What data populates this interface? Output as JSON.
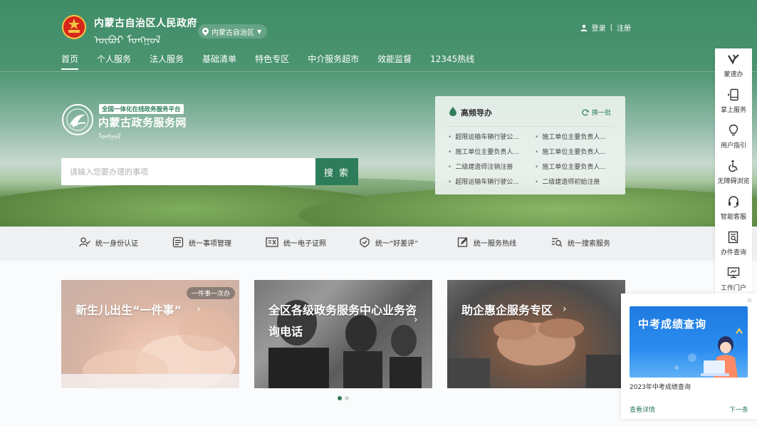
{
  "header": {
    "site_title": "内蒙古自治区人民政府",
    "site_title_mongol": "ᠦᠪᠦᠷ ᠮᠣᠩᠭᠣᠯ",
    "region": "内蒙古自治区",
    "login": "登录",
    "separator": "|",
    "register": "注册"
  },
  "nav": {
    "items": [
      {
        "label": "首页",
        "active": true
      },
      {
        "label": "个人服务"
      },
      {
        "label": "法人服务"
      },
      {
        "label": "基础清单"
      },
      {
        "label": "特色专区"
      },
      {
        "label": "中介服务超市"
      },
      {
        "label": "效能监督"
      },
      {
        "label": "12345热线"
      }
    ]
  },
  "brand": {
    "tag": "全国一体化在线政务服务平台",
    "name": "内蒙古政务服务网",
    "name_mongol": "ᠮᠣᠩᠭᠣᠯ"
  },
  "search": {
    "placeholder": "请输入您要办理的事项",
    "button": "搜 索"
  },
  "hot_panel": {
    "title": "高频导办",
    "refresh": "换一批",
    "items": [
      "超限运输车辆行驶公...",
      "施工单位主要负责人...",
      "施工单位主要负责人...",
      "施工单位主要负责人...",
      "二级建造师注销注册",
      "施工单位主要负责人...",
      "超限运输车辆行驶公...",
      "二级建造师初始注册"
    ]
  },
  "services": [
    {
      "label": "统一身份认证",
      "icon": "identity-icon"
    },
    {
      "label": "统一事项管理",
      "icon": "list-icon"
    },
    {
      "label": "统一电子证照",
      "icon": "certificate-icon"
    },
    {
      "label": "统一“好差评”",
      "icon": "rating-icon"
    },
    {
      "label": "统一服务热线",
      "icon": "hotline-icon"
    },
    {
      "label": "统一搜索服务",
      "icon": "search-service-icon"
    }
  ],
  "cards": [
    {
      "title": "新生儿出生“一件事”",
      "badge": "一件事一次办"
    },
    {
      "title": "全区各级政务服务中心业务咨询电话"
    },
    {
      "title": "助企惠企服务专区"
    }
  ],
  "carousel": {
    "count": 2,
    "active": 0
  },
  "sidebar": {
    "items": [
      {
        "label": "蒙速办",
        "icon": "mengsuban-icon"
      },
      {
        "label": "掌上服务",
        "icon": "mobile-icon"
      },
      {
        "label": "用户指引",
        "icon": "bulb-icon"
      },
      {
        "label": "无障碍浏览",
        "icon": "accessibility-icon"
      },
      {
        "label": "智能客服",
        "icon": "headset-icon"
      },
      {
        "label": "办件查询",
        "icon": "query-icon"
      },
      {
        "label": "工作门户",
        "icon": "monitor-icon"
      }
    ]
  },
  "popup": {
    "close": "×",
    "banner_title": "中考成绩查询",
    "desc": "2023年中考成绩查询",
    "detail": "查看详情",
    "next": "下一条"
  },
  "colors": {
    "primary": "#2e7d5a",
    "hero_top": "#3f8d68"
  }
}
